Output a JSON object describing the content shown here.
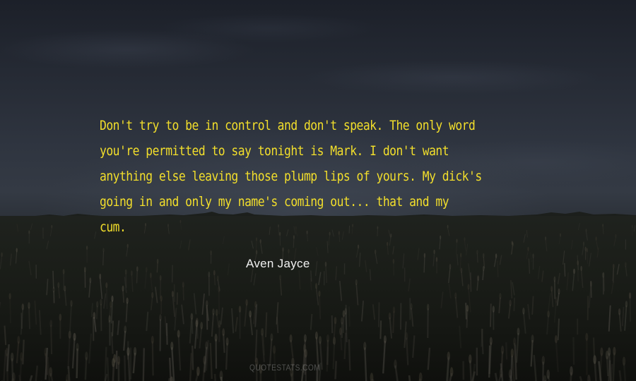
{
  "quote": {
    "text": "Don't try to be in control and don't speak. The only word\nyou're permitted to say tonight is Mark. I don't want\nanything else leaving those plump lips of yours. My dick's\ngoing in and only my name's coming out... that and my\ncum.",
    "text_color": "#f3df2b"
  },
  "author": {
    "name": "Aven Jayce",
    "color": "#f0f0f0"
  },
  "watermark": {
    "text": "QUOTESTATS.COM"
  },
  "background": {
    "description_colors": {
      "sky": "#2f3540",
      "field": "#1b1e19"
    }
  }
}
